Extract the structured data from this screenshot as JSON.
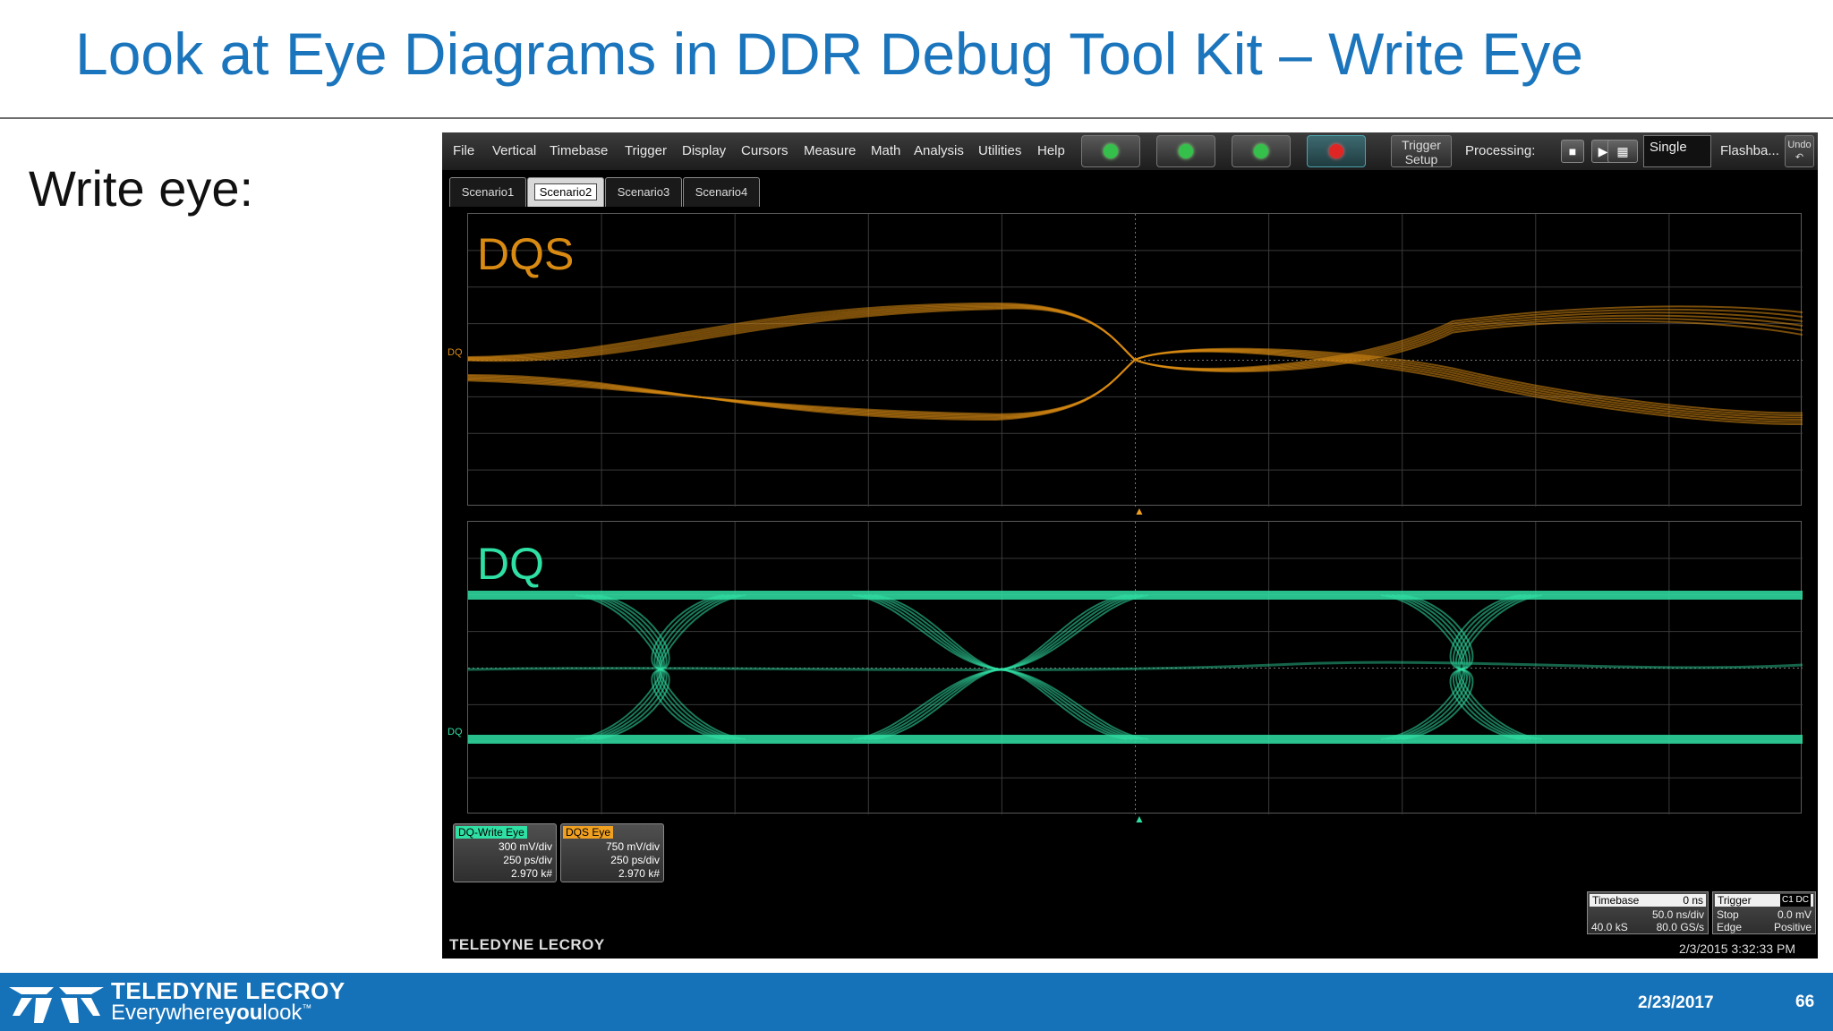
{
  "slide": {
    "title": "Look at Eye Diagrams in DDR Debug Tool Kit – Write Eye",
    "bullet": "Write eye:",
    "footer_logo_line1": "TELEDYNE LECROY",
    "footer_logo_line2_a": "Everywhere",
    "footer_logo_line2_b": "you",
    "footer_logo_line2_c": "look",
    "footer_logo_tm": "™",
    "footer_date": "2/23/2017",
    "page_number": "66"
  },
  "scope": {
    "menu": [
      "File",
      "Vertical",
      "Timebase",
      "Trigger",
      "Display",
      "Cursors",
      "Measure",
      "Math",
      "Analysis",
      "Utilities",
      "Help"
    ],
    "trigger_setup_line1": "Trigger",
    "trigger_setup_line2": "Setup",
    "processing_label": "Processing:",
    "single_label": "Single",
    "flashback_label": "Flashba...",
    "undo_label": "Undo",
    "tabs": [
      "Scenario1",
      "Scenario2",
      "Scenario3",
      "Scenario4"
    ],
    "active_tab": "Scenario2",
    "top_trace_label": "DQS",
    "bottom_trace_label": "DQ",
    "top_marker": "DQ",
    "bottom_marker": "DQ",
    "colors": {
      "dqs": "#d98a12",
      "dq": "#2fe0a4",
      "grid": "#3a3a3a"
    },
    "descriptors": [
      {
        "name": "DQ-Write Eye",
        "color": "#2fe0a4",
        "vdiv": "300 mV/div",
        "hdiv": "250 ps/div",
        "count": "2.970 k#"
      },
      {
        "name": "DQS Eye",
        "color": "#f0a020",
        "vdiv": "750 mV/div",
        "hdiv": "250 ps/div",
        "count": "2.970 k#"
      }
    ],
    "timebase": {
      "label": "Timebase",
      "delay": "0 ns",
      "tdiv": "50.0 ns/div",
      "samples": "40.0 kS",
      "rate": "80.0 GS/s"
    },
    "trigger": {
      "label": "Trigger",
      "channel": "C1 DC",
      "mode": "Stop",
      "level": "0.0 mV",
      "type": "Edge",
      "slope": "Positive"
    },
    "brand": "TELEDYNE LECROY",
    "timestamp": "2/3/2015 3:32:33 PM"
  }
}
